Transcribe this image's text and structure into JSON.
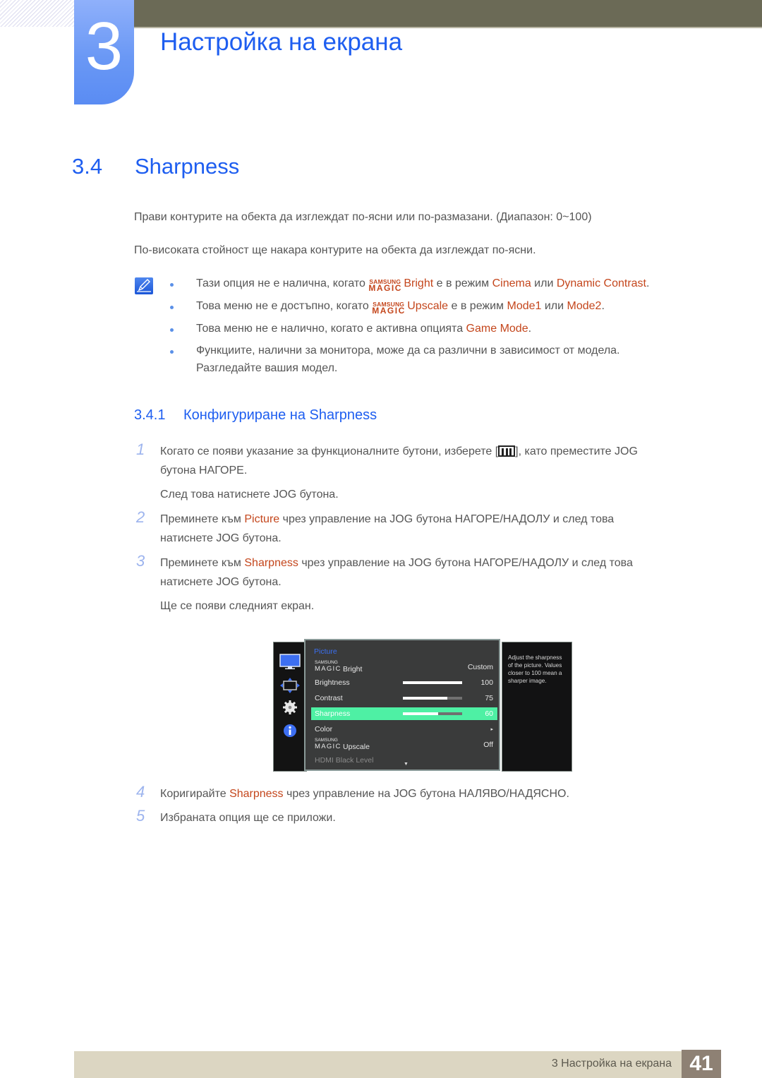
{
  "header": {
    "chapter_number": "3",
    "chapter_title": "Настройка на екрана"
  },
  "section": {
    "number": "3.4",
    "title": "Sharpness",
    "paragraphs": [
      "Прави контурите на обекта да изглеждат по-ясни или по-размазани. (Диапазон: 0~100)",
      "По-високата стойност ще накара контурите на обекта да изглеждат по-ясни."
    ]
  },
  "notes": {
    "icon": "note-pencil-icon",
    "magic_brand_top": "SAMSUNG",
    "magic_brand_bottom": "MAGIC",
    "items": [
      {
        "pre": "Тази опция не е налична, когато ",
        "magic": "Bright",
        "mid1": " е в режим ",
        "hl1": "Cinema",
        "mid2": " или ",
        "hl2": "Dynamic Contrast",
        "post": "."
      },
      {
        "pre": "Това меню не е достъпно, когато ",
        "magic": "Upscale",
        "mid1": " е в режим ",
        "hl1": "Mode1",
        "mid2": " или ",
        "hl2": "Mode2",
        "post": "."
      },
      {
        "pre": "Това меню не е налично, когато е активна опцията ",
        "hl1": "Game Mode",
        "post": "."
      },
      {
        "line1": "Функциите, налични за монитора, може да са различни в зависимост от модела.",
        "line2": "Разгледайте вашия модел."
      }
    ]
  },
  "subsection": {
    "number": "3.4.1",
    "title": "Конфигуриране на Sharpness"
  },
  "steps": [
    {
      "num": "1",
      "line1_pre": "Когато се появи указание за функционалните бутони, изберете [",
      "icon": "menu-icon",
      "line1_post": "], като преместите JOG",
      "line2": "бутона НАГОРЕ.",
      "extra": "След това натиснете JOG бутона."
    },
    {
      "num": "2",
      "pre": "Преминете към ",
      "hl": "Picture",
      "post": " чрез управление на JOG бутона НАГОРЕ/НАДОЛУ и след това",
      "line2": "натиснете JOG бутона."
    },
    {
      "num": "3",
      "pre": "Преминете към ",
      "hl": "Sharpness",
      "post": " чрез управление на JOG бутона НАГОРЕ/НАДОЛУ и след това",
      "line2": "натиснете JOG бутона.",
      "extra": "Ще се появи следният екран."
    },
    {
      "num": "4",
      "pre": "Коригирайте ",
      "hl": "Sharpness",
      "post": " чрез управление на JOG бутона НАЛЯВО/НАДЯСНО."
    },
    {
      "num": "5",
      "text": "Избраната опция ще се приложи."
    }
  ],
  "osd": {
    "side_icons": [
      "monitor-icon",
      "position-arrows-icon",
      "gear-icon",
      "info-icon"
    ],
    "category": "Picture",
    "magic_top": "SAMSUNG",
    "magic_bottom": "MAGIC",
    "rows": [
      {
        "label": "Bright",
        "magic": true,
        "value": "Custom"
      },
      {
        "label": "Brightness",
        "value": "100",
        "level": 100
      },
      {
        "label": "Contrast",
        "value": "75",
        "level": 75
      },
      {
        "label": "Sharpness",
        "value": "60",
        "level": 60,
        "selected": true
      },
      {
        "label": "Color",
        "value": "▸"
      },
      {
        "label": "Upscale",
        "magic": true,
        "value": "Off"
      },
      {
        "label": "HDMI Black Level",
        "dimmed": true
      }
    ],
    "more_indicator": "▼",
    "help_text": "Adjust the sharpness of the picture. Values closer to 100 mean a sharper image."
  },
  "footer": {
    "text": "3 Настройка на екрана",
    "page_number": "41"
  },
  "colors": {
    "heading_blue": "#1e5ef0",
    "highlight_orange": "#c4461c",
    "osd_selected": "#4ef0a4"
  }
}
